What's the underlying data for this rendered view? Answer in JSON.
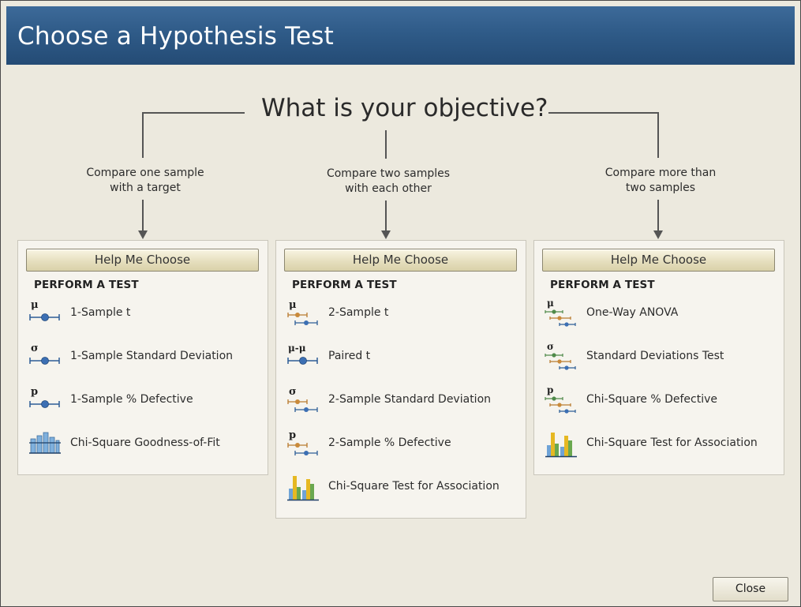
{
  "window": {
    "title": "Choose a Hypothesis Test"
  },
  "objective": "What is your objective?",
  "branches": [
    {
      "line1": "Compare one sample",
      "line2": "with a target"
    },
    {
      "line1": "Compare two samples",
      "line2": "with each other"
    },
    {
      "line1": "Compare more than",
      "line2": "two samples"
    }
  ],
  "help_label": "Help Me Choose",
  "perform_label": "PERFORM A TEST",
  "panels": [
    {
      "tests": [
        {
          "label": "1-Sample t",
          "symbol": "μ",
          "icon": "one-sample-mean-icon"
        },
        {
          "label": "1-Sample Standard Deviation",
          "symbol": "σ",
          "icon": "one-sample-stdev-icon"
        },
        {
          "label": "1-Sample % Defective",
          "symbol": "p",
          "icon": "one-sample-proportion-icon"
        },
        {
          "label": "Chi-Square Goodness-of-Fit",
          "icon": "goodness-of-fit-chart-icon"
        }
      ]
    },
    {
      "tests": [
        {
          "label": "2-Sample t",
          "symbol": "μ",
          "icon": "two-sample-mean-icon"
        },
        {
          "label": "Paired t",
          "symbol": "μ-μ",
          "icon": "paired-difference-icon"
        },
        {
          "label": "2-Sample Standard Deviation",
          "symbol": "σ",
          "icon": "two-sample-stdev-icon"
        },
        {
          "label": "2-Sample % Defective",
          "symbol": "p",
          "icon": "two-sample-proportion-icon"
        },
        {
          "label": "Chi-Square Test for Association",
          "icon": "association-bar-chart-icon"
        }
      ]
    },
    {
      "tests": [
        {
          "label": "One-Way ANOVA",
          "symbol": "μ",
          "icon": "anova-icon"
        },
        {
          "label": "Standard Deviations Test",
          "symbol": "σ",
          "icon": "multi-stdev-icon"
        },
        {
          "label": "Chi-Square % Defective",
          "symbol": "p",
          "icon": "multi-proportion-icon"
        },
        {
          "label": "Chi-Square Test for Association",
          "icon": "association-bar-chart-icon"
        }
      ]
    }
  ],
  "close_label": "Close",
  "colors": {
    "title_bar": "#2f5b88",
    "background": "#ece9de",
    "blue_marker": "#3c6fb3",
    "orange_marker": "#c98a3a",
    "green_marker": "#4f8a4a",
    "gold_bar": "#e6b822"
  }
}
